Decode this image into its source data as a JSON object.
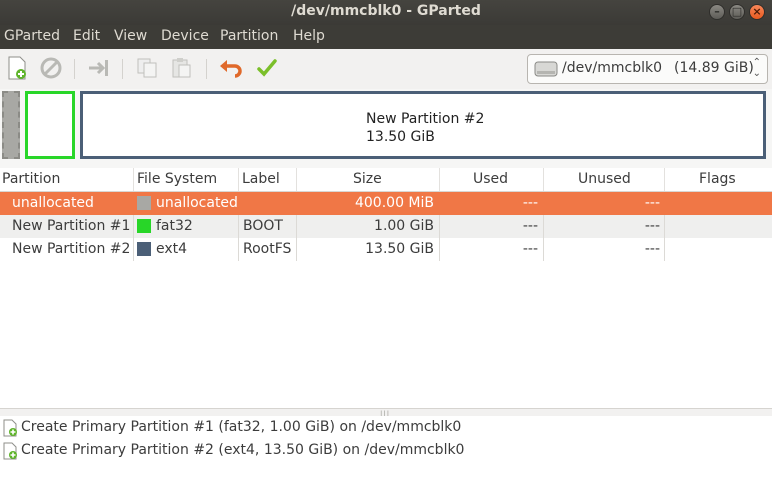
{
  "window": {
    "title": "/dev/mmcblk0 - GParted"
  },
  "menu": [
    "GParted",
    "Edit",
    "View",
    "Device",
    "Partition",
    "Help"
  ],
  "toolbar": {
    "buttons": [
      "new-icon",
      "delete-icon",
      "resize-move-icon",
      "copy-icon",
      "paste-icon",
      "undo-icon",
      "apply-icon"
    ],
    "device_name": "/dev/mmcblk0",
    "device_size": "(14.89 GiB)"
  },
  "diskmap": {
    "selected_name": "New Partition #2",
    "selected_size": "13.50 GiB",
    "colors": {
      "unallocated": "#a8a8a4",
      "fat32": "#28d628",
      "ext4": "#4b5f77"
    }
  },
  "table": {
    "columns": [
      "Partition",
      "File System",
      "Label",
      "Size",
      "Used",
      "Unused",
      "Flags"
    ],
    "rows": [
      {
        "partition": "unallocated",
        "filesystem": "unallocated",
        "label": "",
        "size": "400.00 MiB",
        "used": "---",
        "unused": "---",
        "flags": "",
        "color": "#a8a8a4"
      },
      {
        "partition": "New Partition #1",
        "filesystem": "fat32",
        "label": "BOOT",
        "size": "1.00 GiB",
        "used": "---",
        "unused": "---",
        "flags": "",
        "color": "#28d628"
      },
      {
        "partition": "New Partition #2",
        "filesystem": "ext4",
        "label": "RootFS",
        "size": "13.50 GiB",
        "used": "---",
        "unused": "---",
        "flags": "",
        "color": "#4b5f77"
      }
    ]
  },
  "operations": [
    "Create Primary Partition #1 (fat32, 1.00 GiB) on /dev/mmcblk0",
    "Create Primary Partition #2 (ext4, 13.50 GiB) on /dev/mmcblk0"
  ]
}
